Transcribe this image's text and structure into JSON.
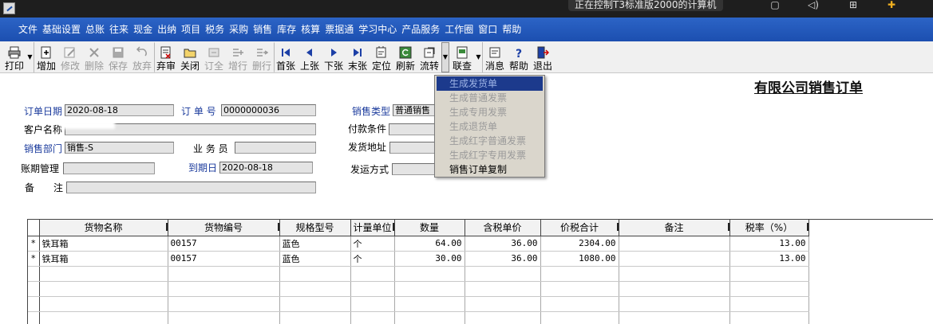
{
  "window": {
    "title": "正在控制T3标准版2000的计算机"
  },
  "menu": [
    "文件",
    "基础设置",
    "总账",
    "往来",
    "现金",
    "出纳",
    "项目",
    "税务",
    "采购",
    "销售",
    "库存",
    "核算",
    "票据通",
    "学习中心",
    "产品服务",
    "工作圈",
    "窗口",
    "帮助"
  ],
  "toolbar": {
    "print": "打印",
    "add": "增加",
    "modify": "修改",
    "delete": "删除",
    "save": "保存",
    "discard": "放弃",
    "abandon_approve": "弃审",
    "close": "关闭",
    "order_complete": "订全",
    "add_row": "增行",
    "delete_row": "删行",
    "first": "首张",
    "prev": "上张",
    "next": "下张",
    "last": "末张",
    "locate": "定位",
    "refresh": "刷新",
    "transfer": "流转",
    "link_query": "联查",
    "message": "消息",
    "help": "帮助",
    "exit": "退出"
  },
  "form": {
    "title": "有限公司销售订单",
    "order_date_label": "订单日期",
    "order_date": "2020-08-18",
    "order_no_label": "订 单 号",
    "order_no": "0000000036",
    "sales_type_label": "销售类型",
    "sales_type": "普通销售",
    "customer_label": "客户名称",
    "customer": "",
    "payment_terms_label": "付款条件",
    "payment_terms": "",
    "dept_label": "销售部门",
    "dept": "销售-S",
    "salesman_label": "业 务 员",
    "salesman": "",
    "ship_address_label": "发货地址",
    "ship_address": "",
    "period_label": "账期管理",
    "period": "",
    "due_date_label": "到期日",
    "due_date": "2020-08-18",
    "ship_method_label": "发运方式",
    "ship_method": "",
    "remark_label": "备　　注",
    "remark": ""
  },
  "dropdown": {
    "items": [
      "生成发货单",
      "生成普通发票",
      "生成专用发票",
      "生成退货单",
      "生成红字普通发票",
      "生成红字专用发票",
      "销售订单复制"
    ]
  },
  "grid": {
    "columns": [
      "货物名称",
      "货物编号",
      "规格型号",
      "计量单位",
      "数量",
      "含税单价",
      "价税合计",
      "备注",
      "税率（%）"
    ],
    "rows": [
      {
        "marker": "*",
        "name": "铁耳箱",
        "code": "00157",
        "spec": "蓝色",
        "unit": "个",
        "qty": "64.00",
        "price": "36.00",
        "total": "2304.00",
        "remark": "",
        "tax": "13.00"
      },
      {
        "marker": "*",
        "name": "铁耳箱",
        "code": "00157",
        "spec": "蓝色",
        "unit": "个",
        "qty": "30.00",
        "price": "36.00",
        "total": "1080.00",
        "remark": "",
        "tax": "13.00"
      }
    ]
  }
}
